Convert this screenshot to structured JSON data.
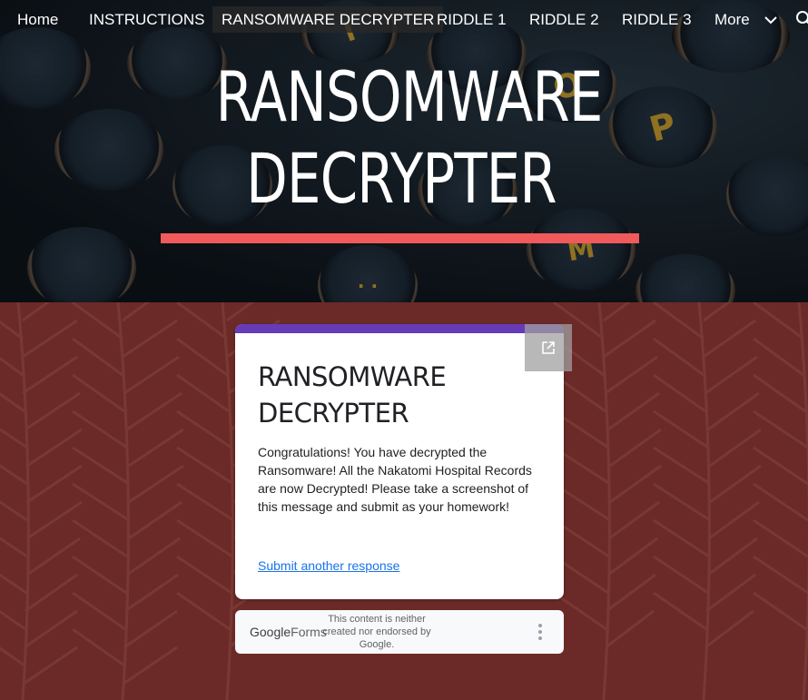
{
  "nav": {
    "items": [
      {
        "label": "Home"
      },
      {
        "label": "INSTRUCTIONS"
      },
      {
        "label": "RANSOMWARE DECRYPTER",
        "active": true
      },
      {
        "label": "RIDDLE 1"
      },
      {
        "label": "RIDDLE 2"
      },
      {
        "label": "RIDDLE 3"
      },
      {
        "label": "More"
      }
    ],
    "more_icon": "chevron-down-icon",
    "search_icon": "search-icon"
  },
  "hero": {
    "title_line1": "RANSOMWARE",
    "title_line2": "DECRYPTER",
    "accent_color": "#f05a5a"
  },
  "form": {
    "title_line1": "RANSOMWARE",
    "title_line2": "DECRYPTER",
    "message": "Congratulations!  You have decrypted the Ransomware!  All the Nakatomi Hospital Records are now Decrypted!  Please take a screenshot of this message and submit as your homework!",
    "link_label": "Submit another response",
    "theme_color": "#673ab7",
    "popout_icon": "open-in-new-icon"
  },
  "footer": {
    "brand_google": "Google",
    "brand_forms": "Forms",
    "disclaimer": "This content is neither created nor endorsed by Google."
  },
  "colors": {
    "background": "#6b2a27",
    "link": "#1a73e8"
  }
}
